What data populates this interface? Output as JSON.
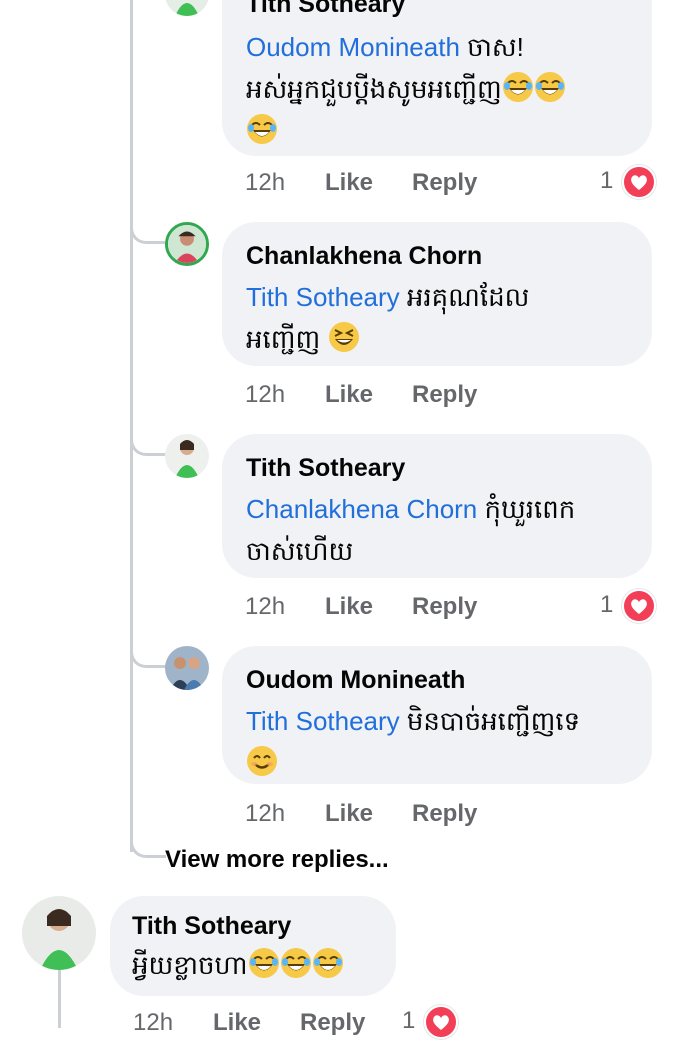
{
  "comments": [
    {
      "author": "Tith Sotheary",
      "mention": "Oudom Monineath",
      "text_line1": " ចាស!",
      "text_line2": "អស់អ្នកជួបប្ដីងសូមអញ្ជើញ",
      "time": "12h",
      "like": "Like",
      "reply": "Reply",
      "reactions": "1"
    },
    {
      "author": "Chanlakhena Chorn",
      "mention": "Tith Sotheary",
      "text_line1": " អរគុណដែល",
      "text_line2": "អញ្ជើញ ",
      "time": "12h",
      "like": "Like",
      "reply": "Reply"
    },
    {
      "author": "Tith Sotheary",
      "mention": "Chanlakhena Chorn",
      "text_line1": " កុំឃួរពេក",
      "text_line2": "ចាស់ហើយ",
      "time": "12h",
      "like": "Like",
      "reply": "Reply",
      "reactions": "1"
    },
    {
      "author": "Oudom Monineath",
      "mention": "Tith Sotheary",
      "text_line1": " មិនបាច់អញ្ជើញទេ",
      "time": "12h",
      "like": "Like",
      "reply": "Reply"
    }
  ],
  "view_more": "View more replies...",
  "top_comment": {
    "author": "Tith Sotheary",
    "text": "អ្វីយខ្លាចហា",
    "time": "12h",
    "like": "Like",
    "reply": "Reply",
    "reactions": "1"
  },
  "icons": {
    "laugh": "laughing-emoji-icon",
    "grin": "grinning-squint-emoji-icon",
    "smile": "smiling-emoji-icon",
    "heart": "love-reaction-icon"
  },
  "colors": {
    "mention": "#216fdb",
    "bubble": "#f0f2f5",
    "heart": "#f33e58",
    "meta": "#65676b"
  }
}
